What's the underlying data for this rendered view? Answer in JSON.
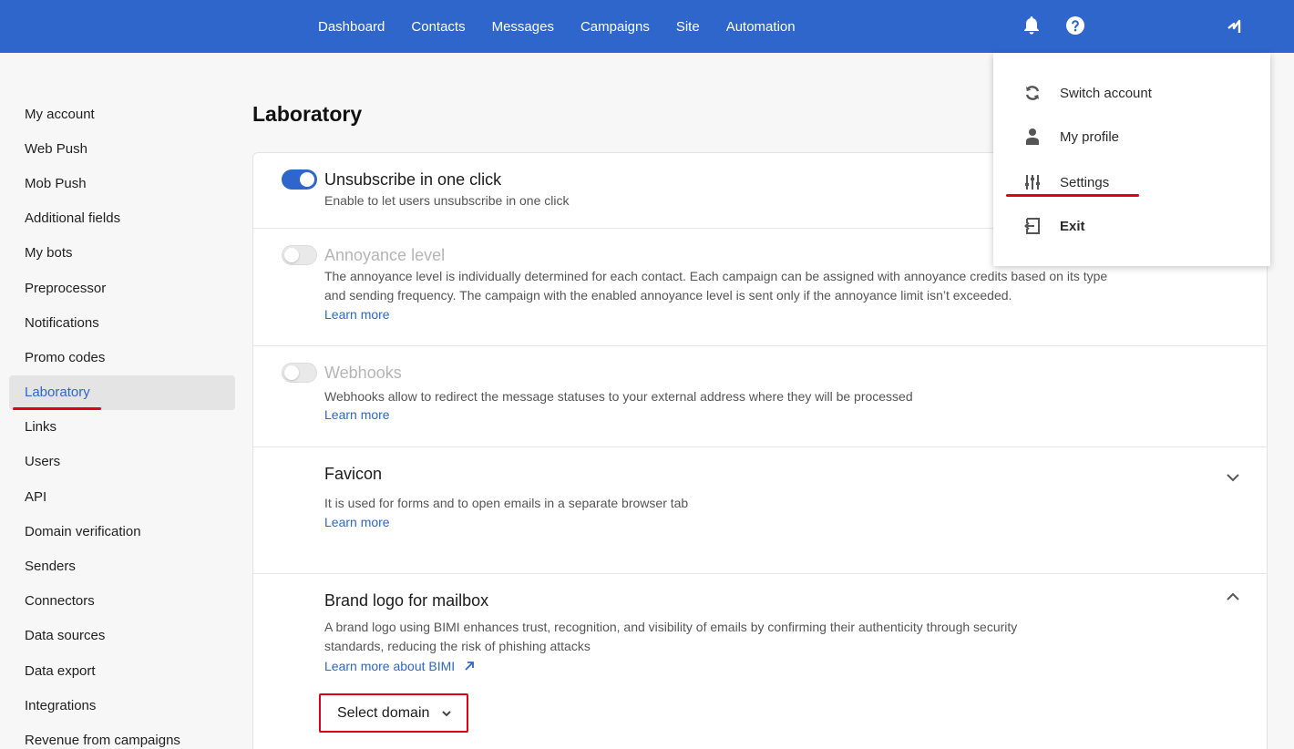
{
  "header": {
    "nav": [
      "Dashboard",
      "Contacts",
      "Messages",
      "Campaigns",
      "Site",
      "Automation"
    ],
    "icons": [
      "bell-icon",
      "help-icon",
      "account-menu-icon"
    ]
  },
  "sidebar": {
    "items": [
      {
        "label": "My account"
      },
      {
        "label": "Web Push"
      },
      {
        "label": "Mob Push"
      },
      {
        "label": "Additional fields"
      },
      {
        "label": "My bots"
      },
      {
        "label": "Preprocessor"
      },
      {
        "label": "Notifications"
      },
      {
        "label": "Promo codes"
      },
      {
        "label": "Laboratory",
        "active": true
      },
      {
        "label": "Links"
      },
      {
        "label": "Users"
      },
      {
        "label": "API"
      },
      {
        "label": "Domain verification"
      },
      {
        "label": "Senders"
      },
      {
        "label": "Connectors"
      },
      {
        "label": "Data sources"
      },
      {
        "label": "Data export"
      },
      {
        "label": "Integrations"
      },
      {
        "label": "Revenue from campaigns"
      }
    ]
  },
  "main": {
    "title": "Laboratory",
    "settings": [
      {
        "title": "Unsubscribe in one click",
        "desc": "Enable to let users unsubscribe in one click",
        "enabled": true
      },
      {
        "title": "Annoyance level",
        "desc": "The annoyance level is individually determined for each contact. Each campaign can be assigned with annoyance credits based on its type and sending frequency. The campaign with the enabled annoyance level is sent only if the annoyance limit isn’t exceeded.",
        "link": "Learn more",
        "enabled": false
      },
      {
        "title": "Webhooks",
        "desc": "Webhooks allow to redirect the message statuses to your external address where they will be processed",
        "link": "Learn more",
        "enabled": false
      },
      {
        "title": "Favicon",
        "desc": "It is used for forms and to open emails in a separate browser tab",
        "link": "Learn more"
      },
      {
        "title": "Brand logo for mailbox",
        "desc": "A brand logo using BIMI enhances trust, recognition, and visibility of emails by confirming their authenticity through security standards, reducing the risk of phishing attacks",
        "link": "Learn more about BIMI",
        "select": "Select domain"
      }
    ]
  },
  "account_menu": {
    "items": [
      {
        "label": "Switch account",
        "icon": "refresh-icon"
      },
      {
        "label": "My profile",
        "icon": "person-icon"
      },
      {
        "label": "Settings",
        "icon": "sliders-icon"
      },
      {
        "label": "Exit",
        "icon": "exit-icon"
      }
    ]
  },
  "colors": {
    "accent": "#2e66cc",
    "highlight": "#e0001a"
  }
}
